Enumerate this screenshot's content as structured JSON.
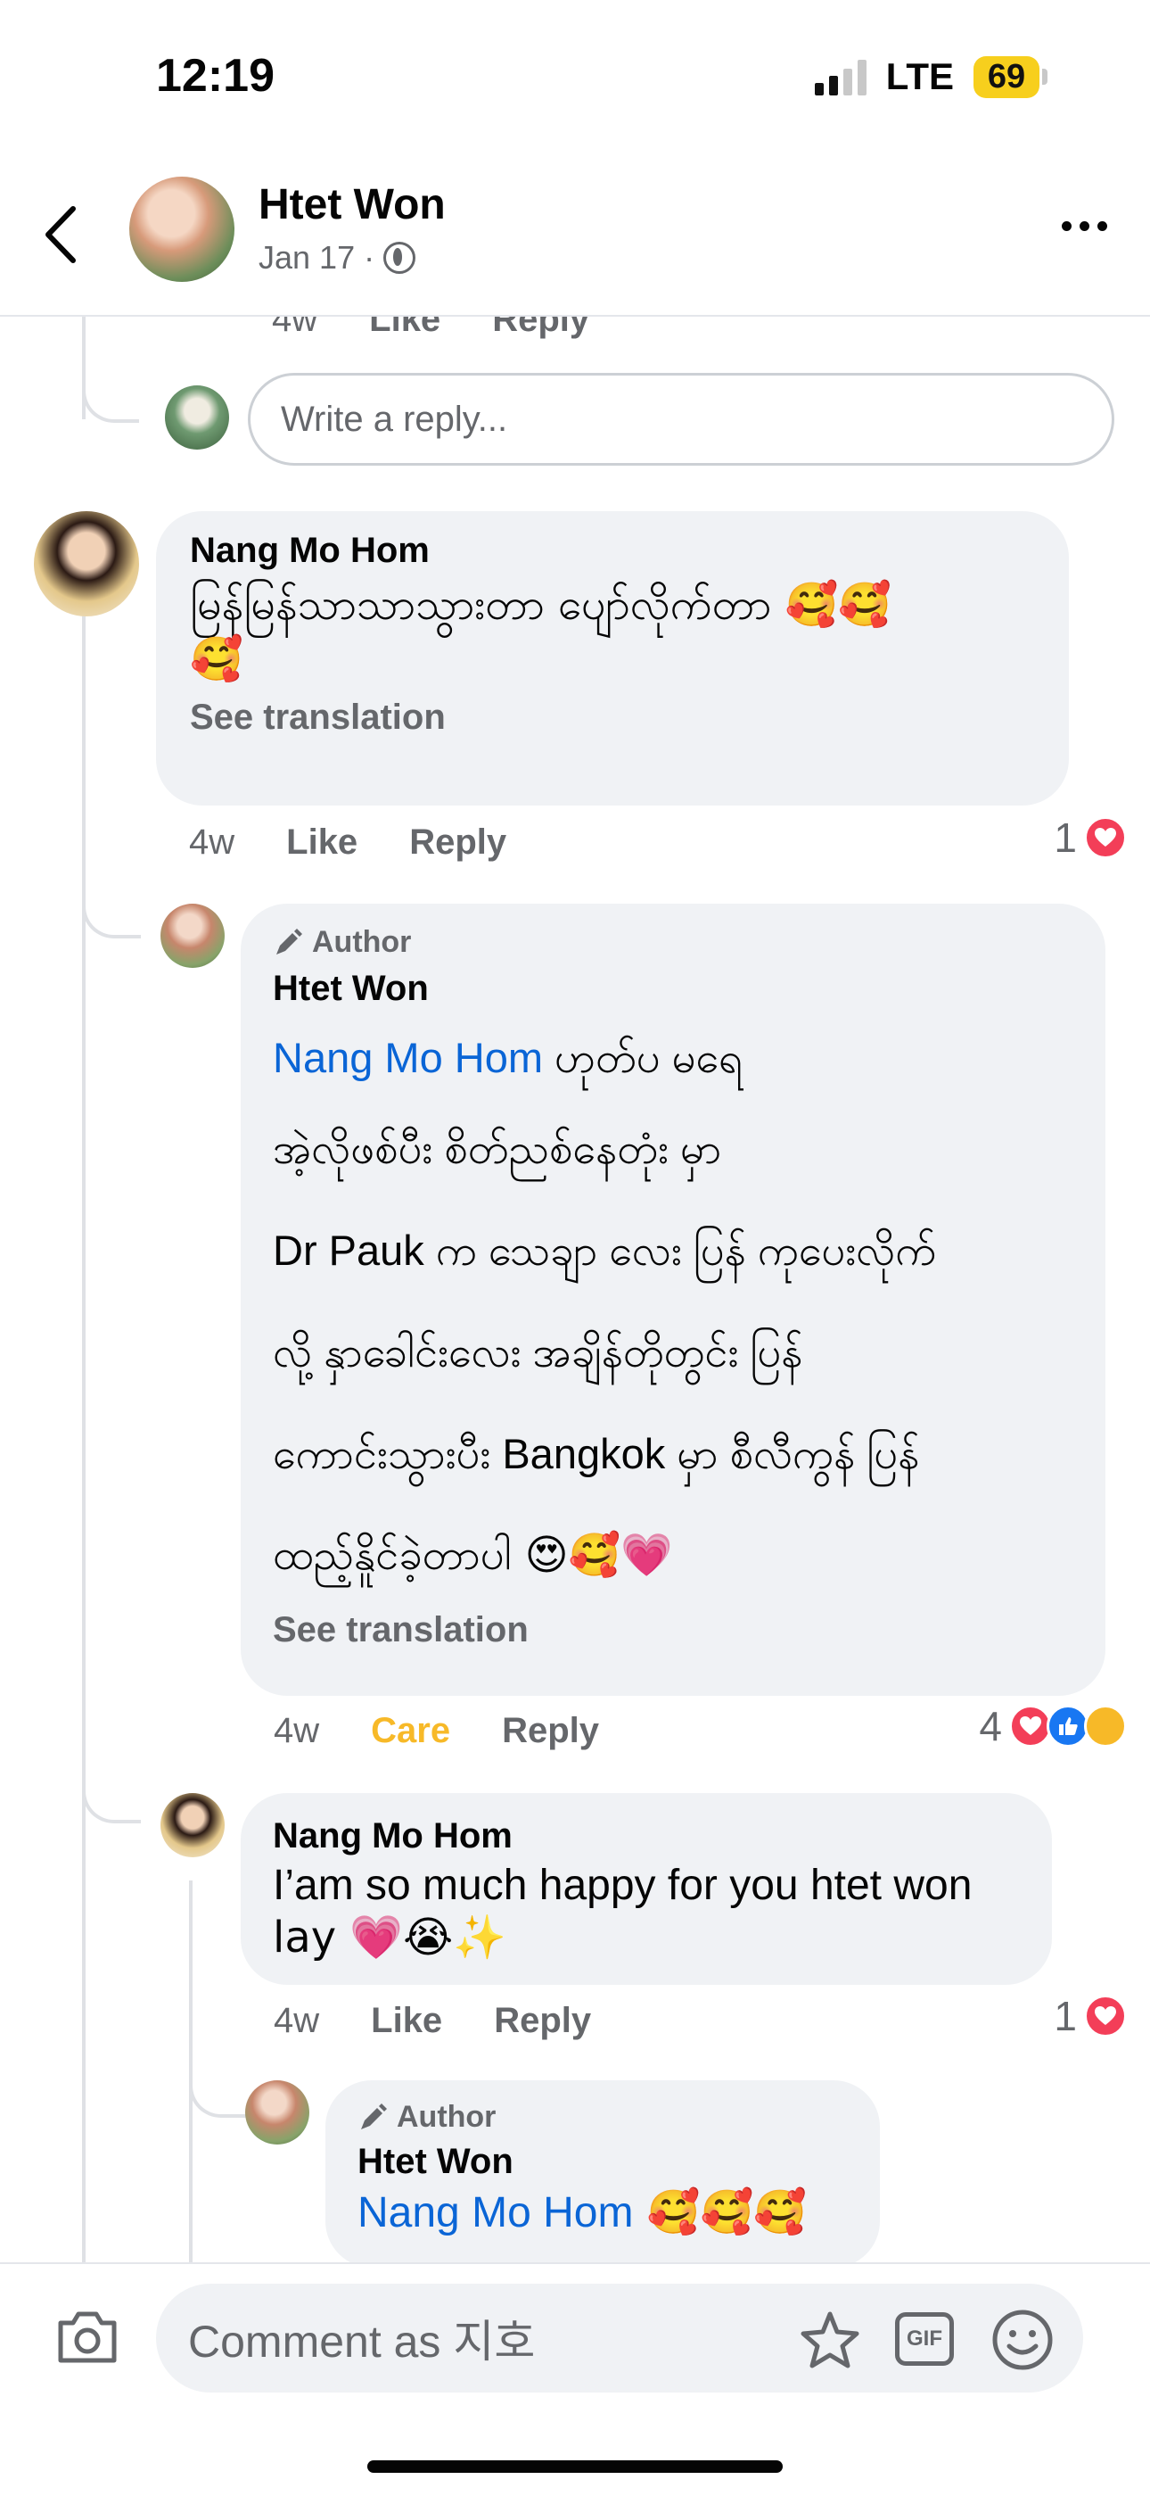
{
  "status_bar": {
    "time": "12:19",
    "network": "LTE",
    "battery": "69"
  },
  "header": {
    "name": "Htet Won",
    "date": "Jan 17",
    "separator": "·"
  },
  "top_meta": {
    "time": "4w",
    "like": "Like",
    "reply": "Reply"
  },
  "reply_box": {
    "placeholder": "Write a reply..."
  },
  "comments": [
    {
      "name": "Nang Mo Hom",
      "text": "မြန်မြန်သာသာသွားတာ ပျော်လိုက်တာ 🥰🥰",
      "text2": "🥰",
      "see_translation": "See translation",
      "time": "4w",
      "like": "Like",
      "reply": "Reply",
      "reaction_count": "1"
    },
    {
      "author_badge": "Author",
      "name": "Htet Won",
      "mention": "Nang Mo Hom",
      "lines": [
        " ဟုတ်ပ မရေ",
        "အဲ့လိုဖစ်ပီး စိတ်ညစ်နေတုံး မှာ",
        "Dr Pauk က သေချာ လေး ပြန် ကုပေးလိုက်",
        "လို့ နှာခေါင်းလေး အချိန်တိုတွင်း ပြန်",
        "ကောင်းသွားပီး Bangkok မှာ စီလီကွန် ပြန်",
        "ထည့်နိူင်ခဲ့တာပါ 😍🥰💗"
      ],
      "see_translation": "See translation",
      "time": "4w",
      "like": "Care",
      "reply": "Reply",
      "reaction_count": "4"
    },
    {
      "name": "Nang Mo Hom",
      "lines": [
        "I’am so much happy for you htet won",
        "lay 💗😭✨"
      ],
      "time": "4w",
      "like": "Like",
      "reply": "Reply",
      "reaction_count": "1"
    },
    {
      "author_badge": "Author",
      "name": "Htet Won",
      "mention": "Nang Mo Hom",
      "text": " 🥰🥰🥰"
    }
  ],
  "bottom_bar": {
    "placeholder": "Comment as 지호",
    "gif": "GIF"
  },
  "colors": {
    "accent": "#0a65d6",
    "care": "#f7b928",
    "love": "#f33e58",
    "like": "#1877f2"
  }
}
